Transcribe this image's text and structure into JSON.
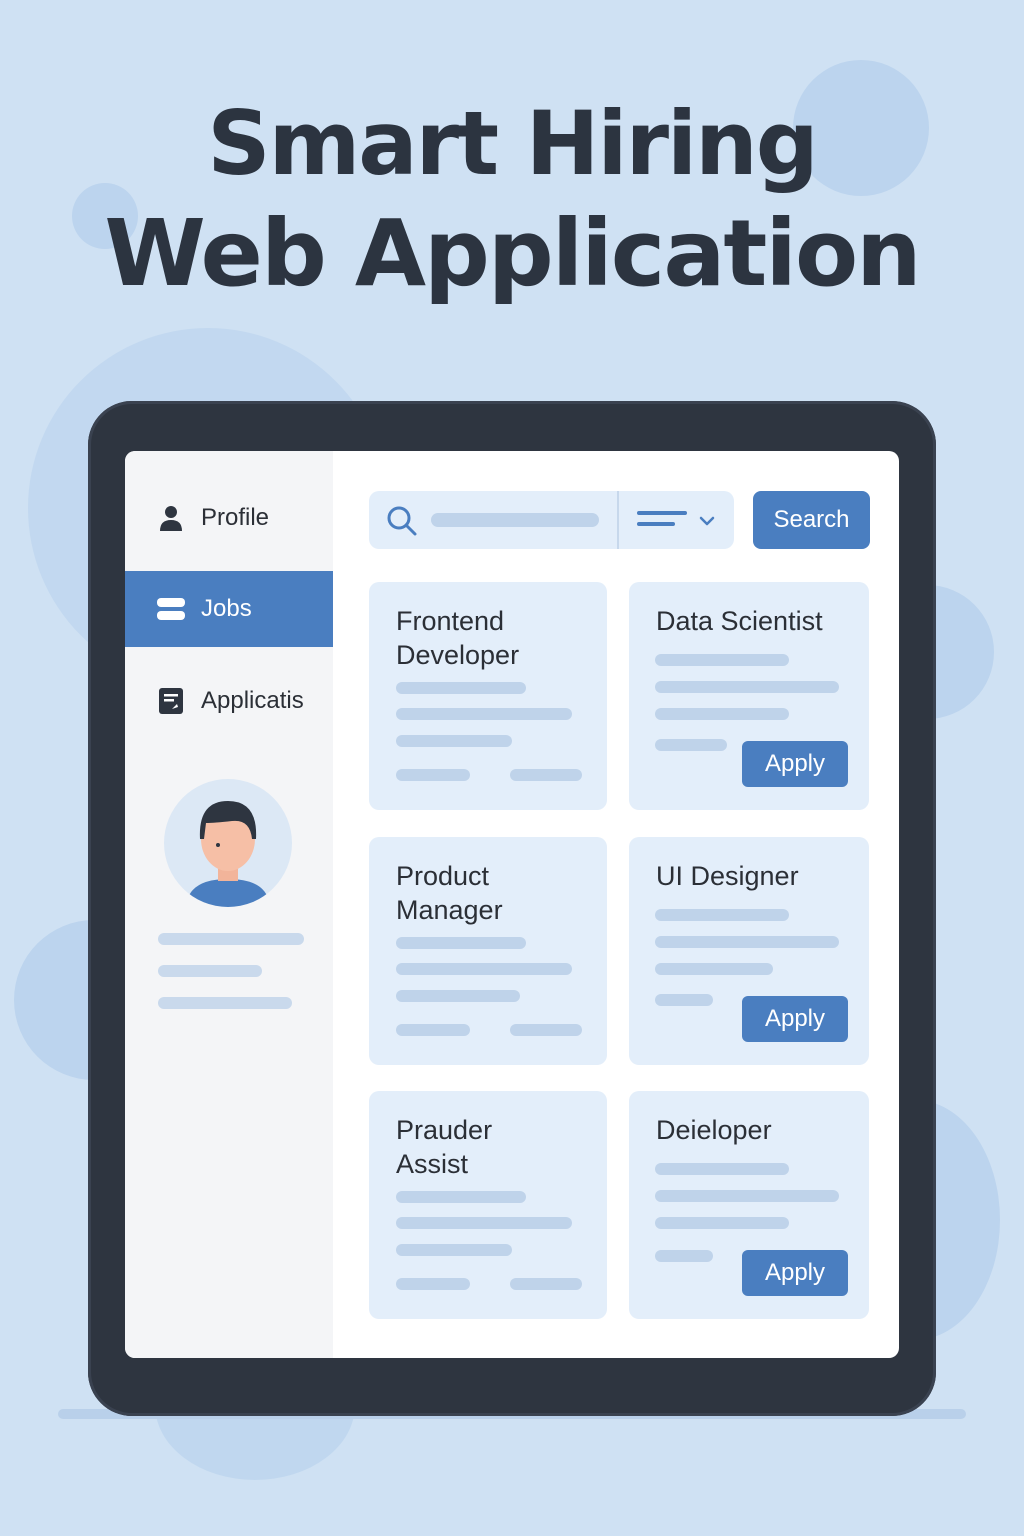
{
  "page": {
    "title_line1": "Smart Hiring",
    "title_line2": "Web Application"
  },
  "sidebar": {
    "items": [
      {
        "label": "Profile",
        "icon": "user-icon",
        "active": false
      },
      {
        "label": "Jobs",
        "icon": "list-icon",
        "active": true
      },
      {
        "label": "Applicatis",
        "icon": "document-icon",
        "active": false
      }
    ],
    "avatar": "avatar-person"
  },
  "search": {
    "button_label": "Search",
    "icon": "search-icon",
    "filter_icon": "filter-icon"
  },
  "jobs": [
    {
      "title": "Frontend\nDeveloper",
      "apply_label": ""
    },
    {
      "title": "Data Scientist",
      "apply_label": "Apply"
    },
    {
      "title": "Product\nManager",
      "apply_label": ""
    },
    {
      "title": "UI Designer",
      "apply_label": "Apply"
    },
    {
      "title": "Prauder\nAssist",
      "apply_label": ""
    },
    {
      "title": "Deieloper",
      "apply_label": "Apply"
    }
  ],
  "colors": {
    "background": "#cfe1f3",
    "accent": "#4a7ec0",
    "device": "#2e3540",
    "card": "#e3eefa"
  }
}
